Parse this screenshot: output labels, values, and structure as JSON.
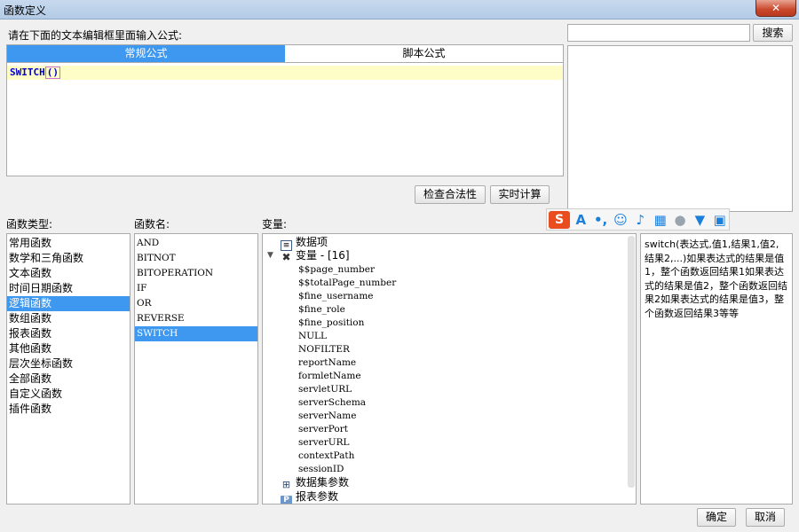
{
  "window": {
    "title": "函数定义",
    "close_label": "✕"
  },
  "editor": {
    "prompt": "请在下面的文本编辑框里面输入公式:",
    "tabs": [
      "常规公式",
      "脚本公式"
    ],
    "formula_func": "SWITCH",
    "formula_args": "()",
    "check_label": "检查合法性",
    "calc_label": "实时计算"
  },
  "search": {
    "value": "",
    "button_label": "搜索"
  },
  "labels": {
    "function_type": "函数类型:",
    "function_name": "函数名:",
    "variables": "变量:"
  },
  "function_types": {
    "items": [
      "常用函数",
      "数学和三角函数",
      "文本函数",
      "时间日期函数",
      "逻辑函数",
      "数组函数",
      "报表函数",
      "其他函数",
      "层次坐标函数",
      "全部函数",
      "自定义函数",
      "插件函数"
    ],
    "selected": "逻辑函数"
  },
  "function_names": {
    "items": [
      "AND",
      "BITNOT",
      "BITOPERATION",
      "IF",
      "OR",
      "REVERSE",
      "SWITCH"
    ],
    "selected": "SWITCH"
  },
  "variables": {
    "dataset_item": "数据项",
    "variables_node": "变量 - [16]",
    "variable_items": [
      "$$page_number",
      "$$totalPage_number",
      "$fine_username",
      "$fine_role",
      "$fine_position",
      "NULL",
      "NOFILTER",
      "reportName",
      "formletName",
      "servletURL",
      "serverSchema",
      "serverName",
      "serverPort",
      "serverURL",
      "contextPath",
      "sessionID"
    ],
    "dataset_params": "数据集参数",
    "report_params": "报表参数"
  },
  "description": "switch(表达式,值1,结果1,值2,结果2,...)如果表达式的结果是值1，整个函数返回结果1如果表达式的结果是值2，整个函数返回结果2如果表达式的结果是值3，整个函数返回结果3等等",
  "ime_toolbar": {
    "logo": "S",
    "icons": [
      "font-icon",
      "punctuation-icon",
      "emoji-icon",
      "microphone-icon",
      "keyboard-icon",
      "user-icon",
      "skin-icon",
      "grid-icon"
    ]
  },
  "footer": {
    "ok_label": "确定",
    "cancel_label": "取消"
  }
}
